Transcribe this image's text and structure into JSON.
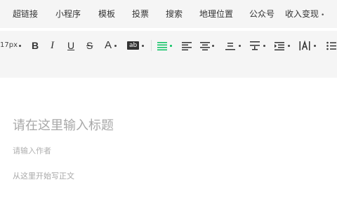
{
  "menubar": {
    "items": [
      {
        "label": "超链接"
      },
      {
        "label": "小程序"
      },
      {
        "label": "模板"
      },
      {
        "label": "投票"
      },
      {
        "label": "搜索"
      },
      {
        "label": "地理位置"
      },
      {
        "label": "公众号"
      },
      {
        "label": "收入变现"
      }
    ],
    "more_caret": "•"
  },
  "toolbar": {
    "font_size": "17px",
    "bold": "B",
    "italic": "I",
    "underline": "U",
    "strikethrough": "S",
    "font_color": "A",
    "highlight": "ab",
    "active_color": "#07c160"
  },
  "editor": {
    "title_placeholder": "请在这里输入标题",
    "author_placeholder": "请输入作者",
    "body_placeholder": "从这里开始写正文"
  }
}
